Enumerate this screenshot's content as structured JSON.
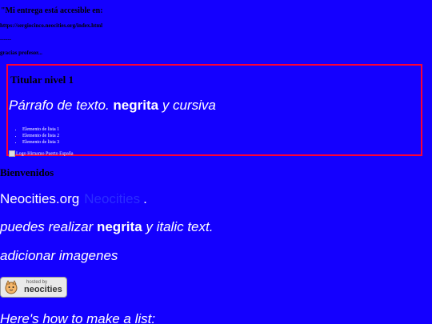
{
  "header": {
    "line1": "\"Mi entrega está accesible en:",
    "url": "https://sergiocinco.neocities.org/index.html",
    "dashes": "------",
    "bye": "gracias profesor..."
  },
  "box": {
    "title": "Titular nivel 1",
    "paragraph_start": "Párrafo de texto. ",
    "paragraph_bold": "negrita",
    "paragraph_end": " y cursiva",
    "list": [
      "Elemento de lista 1",
      "Elemento de lista 2",
      "Elemento de lista 3"
    ],
    "image_alt": "Logo Hirnamo Puerto España"
  },
  "main": {
    "heading": "Bienvenidos",
    "neocities": "Neocities.org",
    "link_text": "Neocities",
    "dot": ".",
    "negrita_start": "puedes realizar ",
    "negrita_bold": "negrita",
    "negrita_end": " y italic text.",
    "imagenes": "adicionar imagenes",
    "list_title": "Here's how to make a list:"
  },
  "badge": {
    "small": "hosted by",
    "big": "neocities",
    "icon": "neocities-cat-icon"
  },
  "colors": {
    "background": "#1400ff",
    "border": "#ff0033",
    "link": "#2a2cff"
  }
}
